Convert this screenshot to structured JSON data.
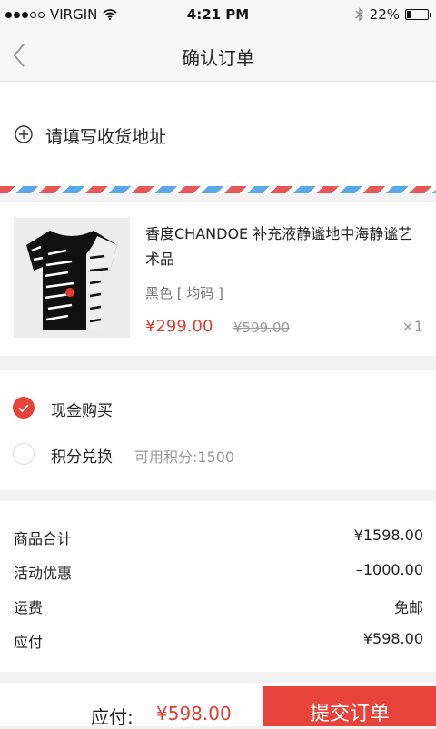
{
  "status_bar": {
    "carrier": "VIRGIN",
    "time": "4:21 PM",
    "battery": "22%",
    "battery_level": 0.22
  },
  "nav": {
    "title": "确认订单",
    "back_icon": "chevron-left-icon"
  },
  "address": {
    "label": "请填写收货地址",
    "icon": "plus-circle-icon"
  },
  "product": {
    "name": "香度CHANDOE 补充液静谧地中海静谧艺术品",
    "spec": "黑色 [ 均码 ]",
    "price": "¥299.00",
    "original_price": "¥599.00",
    "quantity": "×1"
  },
  "payment": {
    "options": [
      {
        "label": "现金购买",
        "selected": true
      },
      {
        "label": "积分兑换",
        "selected": false,
        "note": "可用积分:1500"
      }
    ]
  },
  "summary": {
    "rows": [
      {
        "label": "商品合计",
        "value": "¥1598.00"
      },
      {
        "label": "活动优惠",
        "value": "–1000.00"
      },
      {
        "label": "运费",
        "value": "免邮"
      },
      {
        "label": "应付",
        "value": "¥598.00"
      }
    ]
  },
  "footer": {
    "pay_label": "应付:",
    "pay_amount": "¥598.00",
    "submit_label": "提交订单"
  },
  "colors": {
    "accent": "#e8433a",
    "price": "#e03c31"
  }
}
